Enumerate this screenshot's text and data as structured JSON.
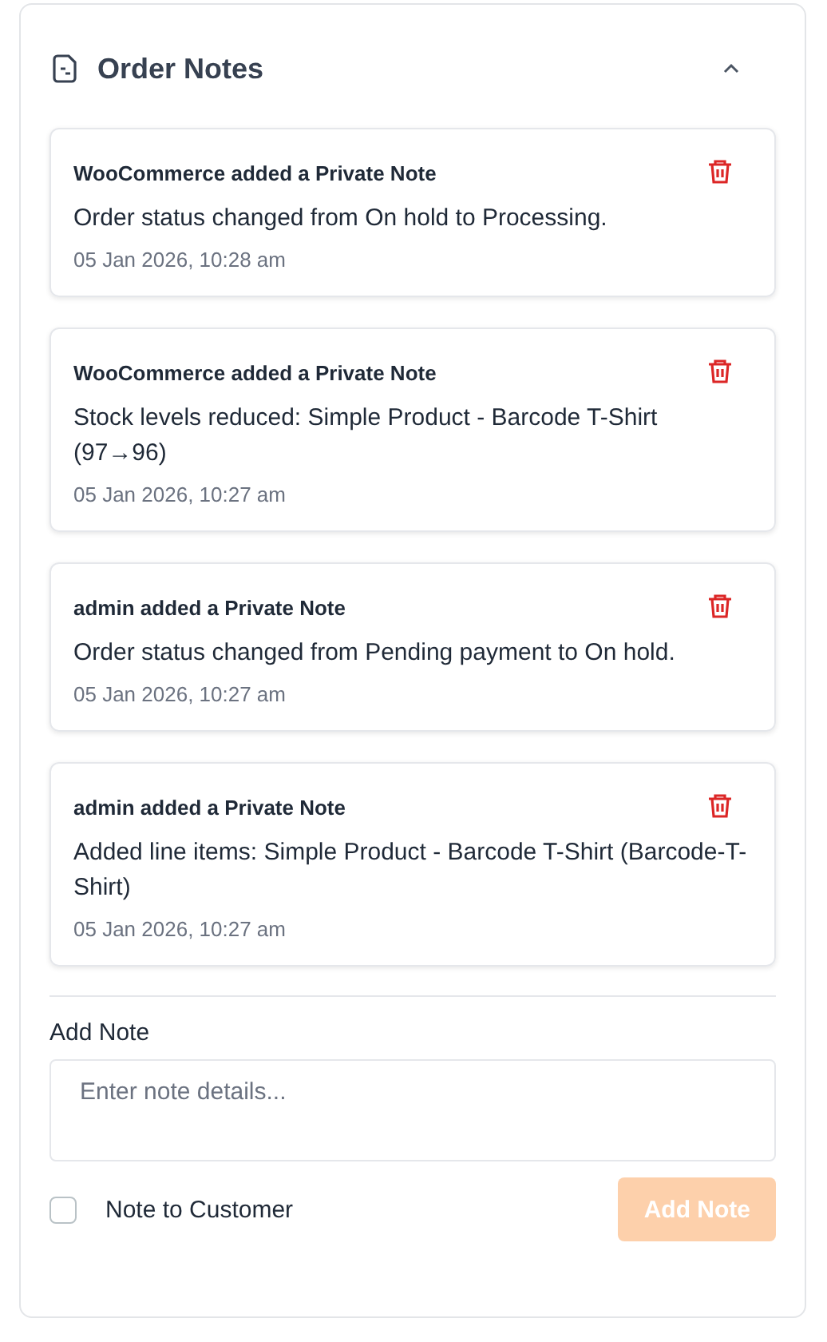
{
  "panel": {
    "title": "Order Notes",
    "expanded": true
  },
  "notes": [
    {
      "author": "WooCommerce added a Private Note",
      "text": "Order status changed from On hold to Processing.",
      "date": "05 Jan 2026, 10:28 am"
    },
    {
      "author": "WooCommerce added a Private Note",
      "text": "Stock levels reduced: Simple Product - Barcode T-Shirt (97→96)",
      "date": "05 Jan 2026, 10:27 am"
    },
    {
      "author": "admin added a Private Note",
      "text": "Order status changed from Pending payment to On hold.",
      "date": "05 Jan 2026, 10:27 am"
    },
    {
      "author": "admin added a Private Note",
      "text": "Added line items: Simple Product - Barcode T-Shirt (Barcode-T-Shirt)",
      "date": "05 Jan 2026, 10:27 am"
    }
  ],
  "add_note": {
    "label": "Add Note",
    "placeholder": "Enter note details...",
    "note_to_customer": {
      "label": "Note to Customer",
      "checked": false
    },
    "button": {
      "label": "Add Note",
      "disabled": true
    }
  }
}
